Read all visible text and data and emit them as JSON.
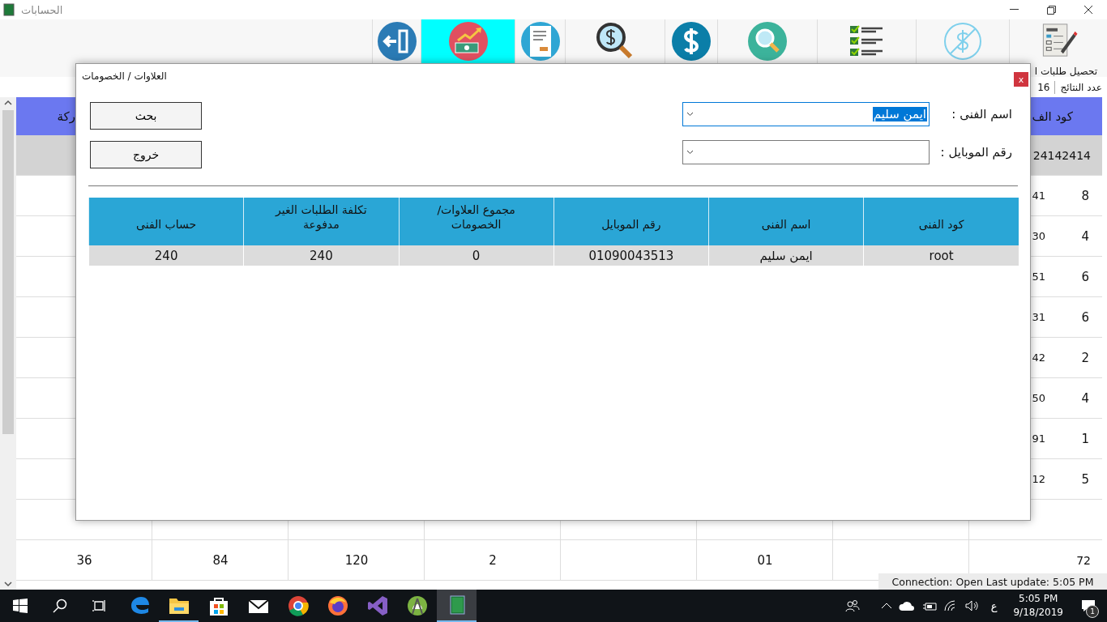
{
  "window": {
    "title": "الحسابات"
  },
  "toolbar": [
    {
      "kind": "order",
      "label": "تحصيل طلبات ا",
      "selected": false
    },
    {
      "kind": "no-dollar",
      "selected": false
    },
    {
      "kind": "checklist",
      "selected": false
    },
    {
      "kind": "search",
      "selected": false
    },
    {
      "kind": "dollar",
      "selected": false
    },
    {
      "kind": "dollar-search",
      "selected": false
    },
    {
      "kind": "receipt",
      "selected": false
    },
    {
      "kind": "money-chart",
      "selected": true
    },
    {
      "kind": "exit",
      "selected": false
    }
  ],
  "results": {
    "label": "عدد النتائج",
    "count": "16"
  },
  "grid": {
    "header": {
      "column_1": "ركة",
      "column_9": "كود الف"
    },
    "rows": [
      {
        "selected": true,
        "column_9": "24142414"
      },
      {
        "selected": false,
        "column_8": "41",
        "column_9": "8"
      },
      {
        "selected": false,
        "column_8": "30",
        "column_9": "4"
      },
      {
        "selected": false,
        "column_8": "51",
        "column_9": "6"
      },
      {
        "selected": false,
        "column_8": "31",
        "column_9": "6"
      },
      {
        "selected": false,
        "column_8": "42",
        "column_9": "2"
      },
      {
        "selected": false,
        "column_8": "50",
        "column_9": "4"
      },
      {
        "selected": false,
        "column_8": "91",
        "column_9": "1"
      },
      {
        "selected": false,
        "column_8": "12",
        "column_9": "5"
      },
      {
        "selected": false
      },
      {
        "selected": false,
        "column_1": "36",
        "column_2": "84",
        "column_3": "120",
        "column_4": "2",
        "column_6": "01",
        "column_9": "72"
      }
    ]
  },
  "dialog": {
    "title": "العلاوات / الخصومات",
    "close": "x",
    "fields": [
      {
        "label": "اسم الفنى :",
        "value": "ايمن سليم",
        "selected": true
      },
      {
        "label": "رقم الموبايل :",
        "selected": false
      }
    ],
    "buttons": [
      "بحث",
      "خروج"
    ],
    "table": {
      "columns": [
        "كود الفنى",
        "اسم الفنى",
        "رقم الموبايل",
        "مجموع العلاوات/الخصومات",
        "تكلفة الطلبات الغير مدفوعة",
        "حساب الفنى"
      ],
      "rows": [
        [
          "root",
          "ايمن سليم",
          "01090043513",
          "0",
          "240",
          "240"
        ]
      ]
    }
  },
  "status_bar": "Connection: Open Last update: 5:05 PM",
  "taskbar": {
    "apps": [
      {
        "kind": "edge",
        "running": false,
        "selected": false
      },
      {
        "kind": "explorer",
        "running": true,
        "selected": false
      },
      {
        "kind": "store",
        "running": false,
        "selected": false
      },
      {
        "kind": "mail",
        "running": false,
        "selected": false
      },
      {
        "kind": "chrome",
        "running": false,
        "selected": false
      },
      {
        "kind": "firefox",
        "running": false,
        "selected": false
      },
      {
        "kind": "visual-studio",
        "running": false,
        "selected": false
      },
      {
        "kind": "android-studio",
        "running": false,
        "selected": false
      },
      {
        "kind": "app",
        "running": true,
        "selected": true
      }
    ],
    "input_language": "ع",
    "time": "5:05 PM",
    "date": "9/18/2019",
    "notifications": "1"
  }
}
